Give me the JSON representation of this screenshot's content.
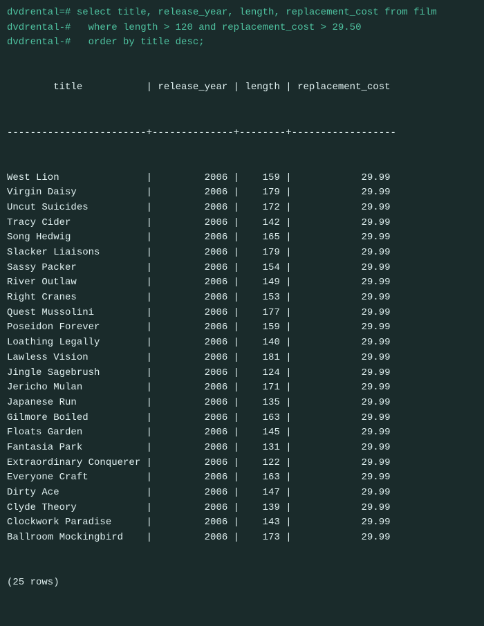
{
  "terminal": {
    "prompt1": "dvdrental=# select title, release_year, length, replacement_cost from film",
    "prompt2": "dvdrental-#   where length > 120 and replacement_cost > 29.50",
    "prompt3": "dvdrental-#   order by title desc;",
    "header": "        title           | release_year | length | replacement_cost",
    "divider": "------------------------+--------------+--------+------------------",
    "rows": [
      "West Lion               |         2006 |    159 |            29.99",
      "Virgin Daisy            |         2006 |    179 |            29.99",
      "Uncut Suicides          |         2006 |    172 |            29.99",
      "Tracy Cider             |         2006 |    142 |            29.99",
      "Song Hedwig             |         2006 |    165 |            29.99",
      "Slacker Liaisons        |         2006 |    179 |            29.99",
      "Sassy Packer            |         2006 |    154 |            29.99",
      "River Outlaw            |         2006 |    149 |            29.99",
      "Right Cranes            |         2006 |    153 |            29.99",
      "Quest Mussolini         |         2006 |    177 |            29.99",
      "Poseidon Forever        |         2006 |    159 |            29.99",
      "Loathing Legally        |         2006 |    140 |            29.99",
      "Lawless Vision          |         2006 |    181 |            29.99",
      "Jingle Sagebrush        |         2006 |    124 |            29.99",
      "Jericho Mulan           |         2006 |    171 |            29.99",
      "Japanese Run            |         2006 |    135 |            29.99",
      "Gilmore Boiled          |         2006 |    163 |            29.99",
      "Floats Garden           |         2006 |    145 |            29.99",
      "Fantasia Park           |         2006 |    131 |            29.99",
      "Extraordinary Conquerer |         2006 |    122 |            29.99",
      "Everyone Craft          |         2006 |    163 |            29.99",
      "Dirty Ace               |         2006 |    147 |            29.99",
      "Clyde Theory            |         2006 |    139 |            29.99",
      "Clockwork Paradise      |         2006 |    143 |            29.99",
      "Ballroom Mockingbird    |         2006 |    173 |            29.99"
    ],
    "row_count": "(25 rows)"
  }
}
